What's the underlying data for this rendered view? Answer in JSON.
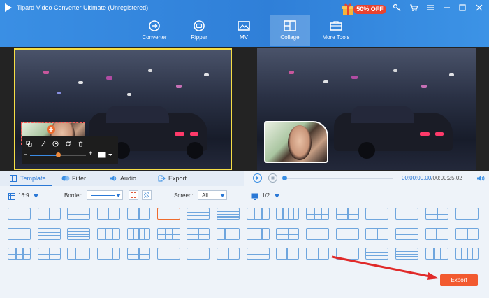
{
  "app": {
    "title": "Tipard Video Converter Ultimate (Unregistered)"
  },
  "promo": {
    "label": "50% OFF"
  },
  "toolbar": {
    "items": [
      {
        "label": "Converter",
        "icon": "converter-icon"
      },
      {
        "label": "Ripper",
        "icon": "ripper-icon"
      },
      {
        "label": "MV",
        "icon": "mv-icon"
      },
      {
        "label": "Collage",
        "icon": "collage-icon",
        "active": true
      },
      {
        "label": "More Tools",
        "icon": "toolbox-icon"
      }
    ]
  },
  "tabs": [
    {
      "label": "Template",
      "icon": "template-icon",
      "active": true
    },
    {
      "label": "Filter",
      "icon": "filter-icon"
    },
    {
      "label": "Audio",
      "icon": "audio-icon"
    },
    {
      "label": "Export",
      "icon": "export-icon"
    }
  ],
  "player": {
    "current_time": "00:00:00.00",
    "total_time": "/00:00:25.02",
    "progress": 0
  },
  "options": {
    "aspect": "16:9",
    "border_label": "Border:",
    "screen_label": "Screen:",
    "screen_value": "All",
    "page": "1/2"
  },
  "templates": {
    "rows": 3,
    "cols": 16,
    "selected_index": 5
  },
  "export_button": {
    "label": "Export"
  },
  "colors": {
    "accent": "#2f7fd8",
    "export": "#f25a30",
    "selection": "#ee6b2d",
    "border_indicator": "#f5dd45"
  }
}
